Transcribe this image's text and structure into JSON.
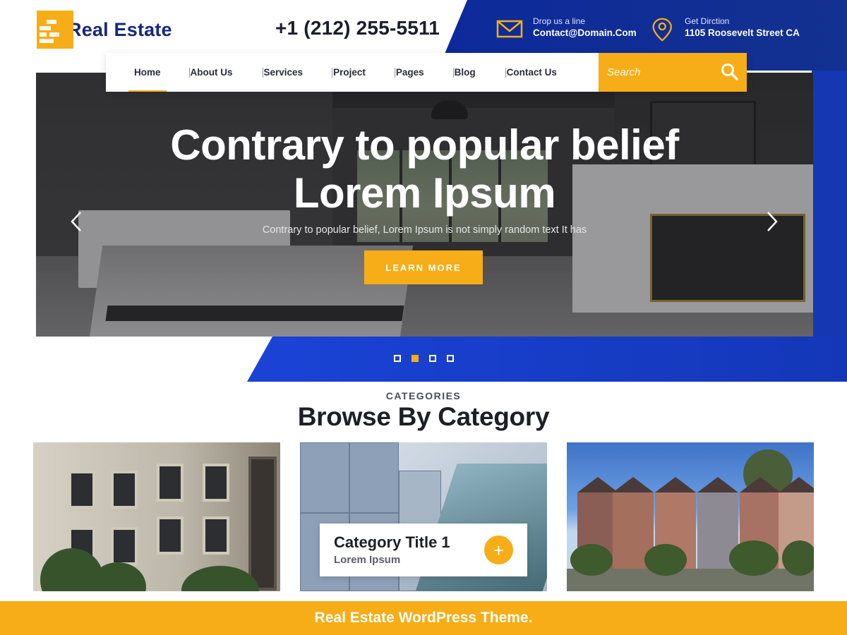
{
  "brand": {
    "name": "Real Estate"
  },
  "header": {
    "phone": "+1 (212) 255-5511",
    "email_label": "Drop us a line",
    "email_value": "Contact@Domain.Com",
    "address_label": "Get Dirction",
    "address_value": "1105 Roosevelt Street CA"
  },
  "nav": {
    "items": [
      {
        "label": "Home",
        "active": true
      },
      {
        "label": "About Us"
      },
      {
        "label": "Services"
      },
      {
        "label": "Project"
      },
      {
        "label": "Pages"
      },
      {
        "label": "Blog"
      },
      {
        "label": "Contact Us"
      }
    ],
    "search_placeholder": "Search"
  },
  "hero": {
    "title_line1": "Contrary to popular belief",
    "title_line2": "Lorem Ipsum",
    "subtitle": "Contrary to popular belief, Lorem Ipsum is not simply random text It has",
    "button_label": "LEARN MORE",
    "slides_total": 4,
    "active_slide": 2
  },
  "categories": {
    "eyebrow": "CATEGORIES",
    "title": "Browse By Category",
    "card_title": "Category Title 1",
    "card_subtitle": "Lorem Ipsum",
    "plus": "+"
  },
  "footer": {
    "text": "Real Estate WordPress Theme."
  },
  "colors": {
    "accent": "#f6ad17",
    "brand_blue": "#1437b8",
    "dark_text": "#1e1f26"
  }
}
